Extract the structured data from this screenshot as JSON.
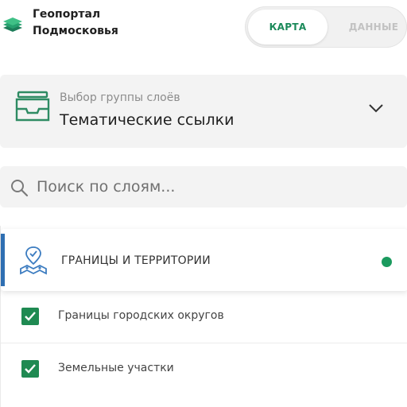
{
  "header": {
    "brand_line1": "Геопортал",
    "brand_line2": "Подмосковья",
    "logo_icon": "layers-logo-icon"
  },
  "mode_switch": {
    "options": [
      {
        "label": "КАРТА",
        "active": true
      },
      {
        "label": "ДАННЫЕ",
        "active": false
      }
    ]
  },
  "group_select": {
    "caption": "Выбор группы слоёв",
    "value": "Тематические ссылки",
    "icon": "inbox-tray-icon",
    "toggle_icon": "chevron-down-icon"
  },
  "search": {
    "placeholder": "Поиск по слоям...",
    "value": "",
    "icon": "search-icon"
  },
  "layer_group": {
    "title": "ГРАНИЦЫ И ТЕРРИТОРИИ",
    "icon": "territory-icon",
    "status": "active",
    "layers": [
      {
        "label": "Границы городских округов",
        "checked": true
      },
      {
        "label": "Земельные участки",
        "checked": true
      }
    ]
  },
  "colors": {
    "accent_green": "#1b8a5a",
    "check_green": "#1f8a52",
    "accent_blue": "#2f6fb2",
    "panel_gray": "#f3f3f3"
  }
}
